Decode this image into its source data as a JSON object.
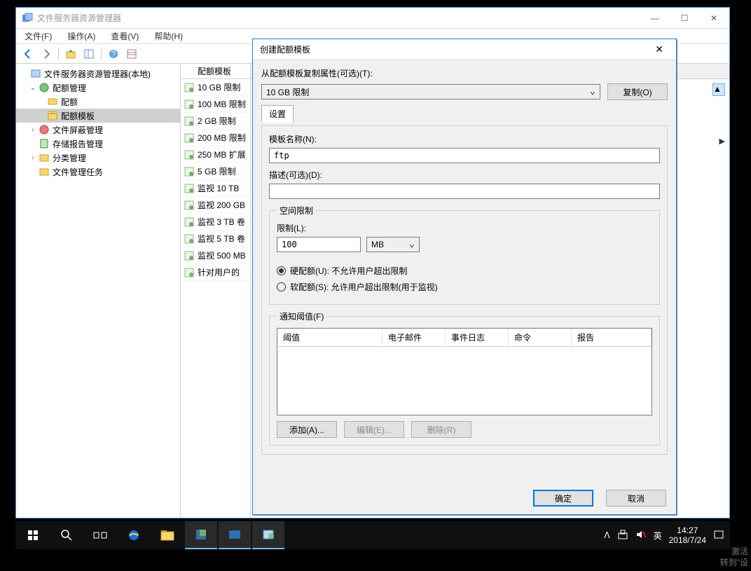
{
  "window": {
    "title": "文件服务器资源管理器",
    "menu": {
      "file": "文件(F)",
      "operate": "操作(A)",
      "view": "查看(V)",
      "help": "帮助(H)"
    }
  },
  "tree": {
    "root": "文件服务器资源管理器(本地)",
    "quota_mgmt": "配额管理",
    "quota": "配额",
    "quota_tpl": "配额模板",
    "screen_mgmt": "文件屏蔽管理",
    "report_mgmt": "存储报告管理",
    "class_mgmt": "分类管理",
    "task_mgmt": "文件管理任务"
  },
  "list": {
    "header": "配额模板",
    "items": [
      "10 GB 限制",
      "100 MB 限制",
      "2 GB 限制",
      "200 MB 限制",
      "250 MB 扩展",
      "5 GB 限制",
      "监视 10 TB",
      "监视 200 GB",
      "监视 3 TB 卷",
      "监视 5 TB 卷",
      "监视 500 MB",
      "针对用户的"
    ]
  },
  "dialog": {
    "title": "创建配额模板",
    "copy_label": "从配额模板复制属性(可选)(T):",
    "copy_value": "10 GB 限制",
    "copy_button": "复制(O)",
    "tab_settings": "设置",
    "name_label": "模板名称(N):",
    "name_value": "ftp",
    "desc_label": "描述(可选)(D):",
    "desc_value": "",
    "space_legend": "空间限制",
    "limit_label": "限制(L):",
    "limit_value": "100",
    "limit_unit": "MB",
    "hard_label": "硬配额(U): 不允许用户超出限制",
    "soft_label": "软配额(S): 允许用户超出限制(用于监视)",
    "thresh_legend": "通知阈值(F)",
    "cols": {
      "c1": "阈值",
      "c2": "电子邮件",
      "c3": "事件日志",
      "c4": "命令",
      "c5": "报告"
    },
    "add_btn": "添加(A)...",
    "edit_btn": "编辑(E)...",
    "del_btn": "删除(R)",
    "ok": "确定",
    "cancel": "取消"
  },
  "taskbar": {
    "ime": "英",
    "time": "14:27",
    "date": "2018/7/24"
  },
  "watermark": {
    "l1": "激活",
    "l2": "转到\"设"
  }
}
